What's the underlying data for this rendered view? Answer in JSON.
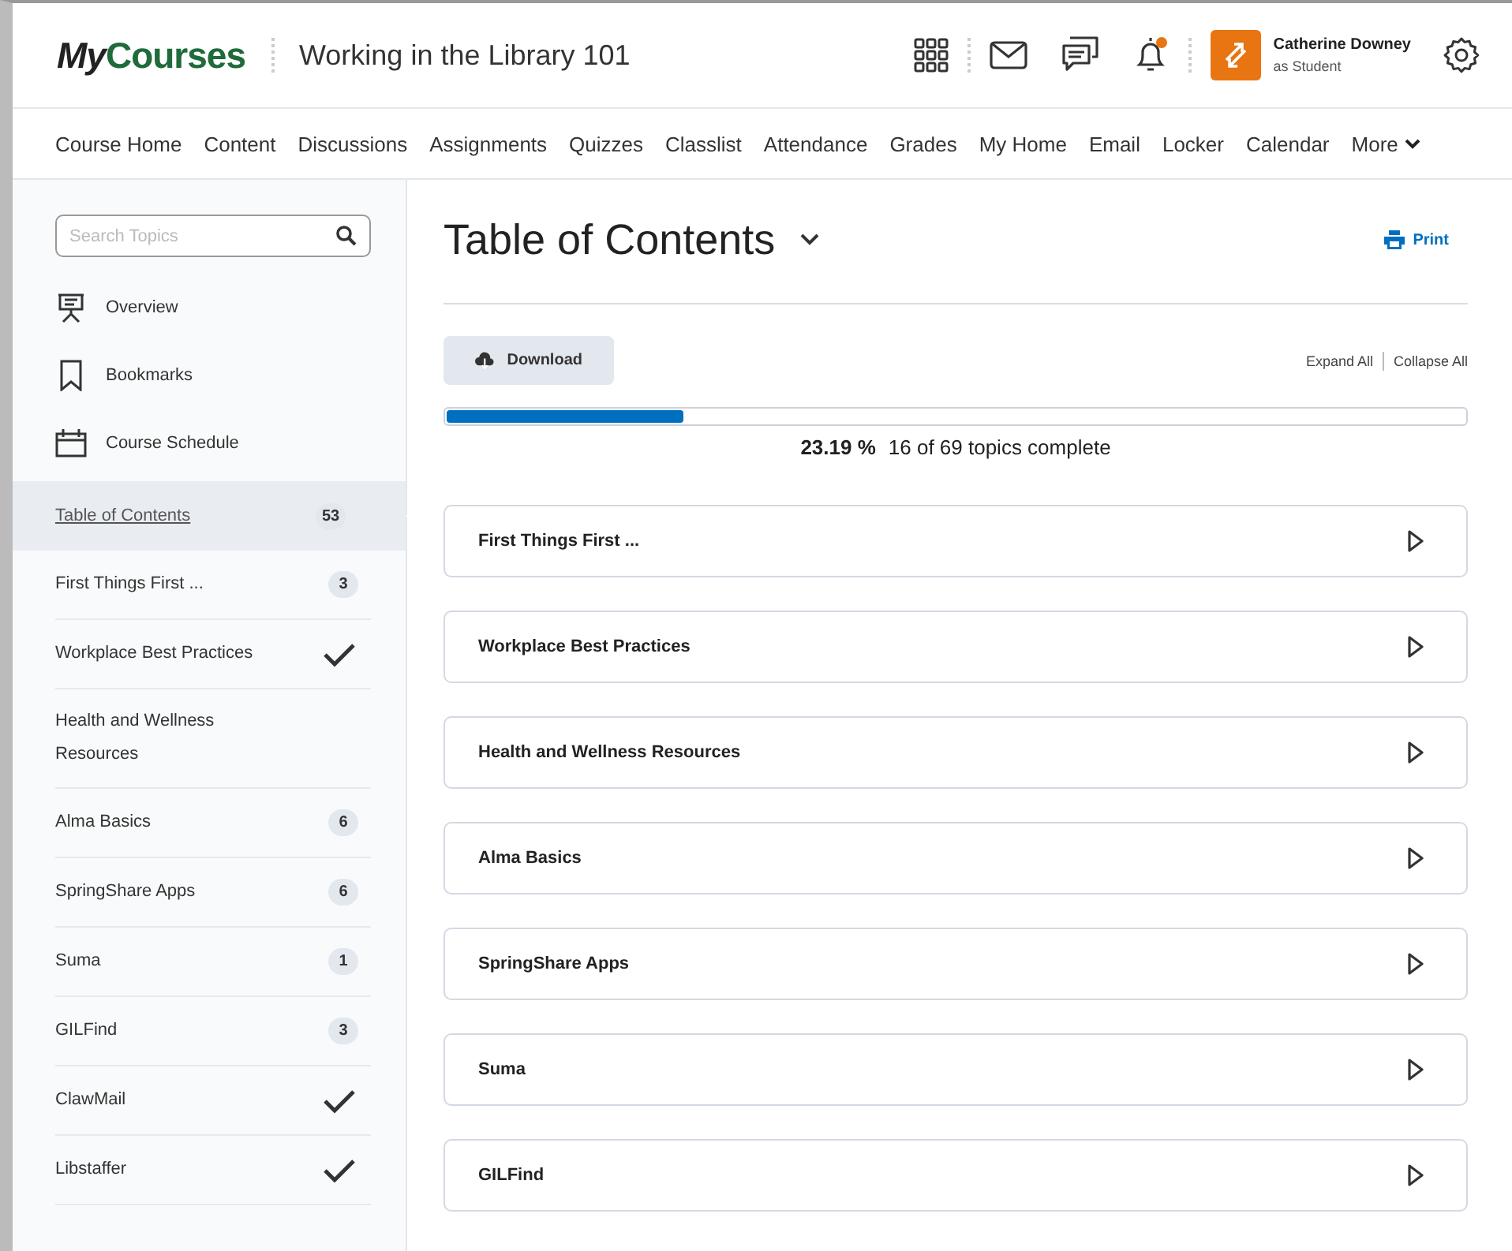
{
  "header": {
    "logo": {
      "part1": "My",
      "part2": "Courses"
    },
    "course_title": "Working in the Library 101",
    "notification_unread": true,
    "user": {
      "name": "Catherine Downey",
      "role": "as Student"
    }
  },
  "nav": {
    "items": [
      "Course Home",
      "Content",
      "Discussions",
      "Assignments",
      "Quizzes",
      "Classlist",
      "Attendance",
      "Grades",
      "My Home",
      "Email",
      "Locker",
      "Calendar"
    ],
    "more": "More"
  },
  "sidebar": {
    "search": {
      "placeholder": "Search Topics"
    },
    "links": [
      {
        "kind": "overview",
        "label": "Overview"
      },
      {
        "kind": "bookmarks",
        "label": "Bookmarks"
      },
      {
        "kind": "schedule",
        "label": "Course Schedule"
      }
    ],
    "modules": [
      {
        "label": "Table of Contents",
        "kind": "count",
        "count": "53",
        "selected": true
      },
      {
        "label": "First Things First ...",
        "kind": "count",
        "count": "3",
        "selected": false
      },
      {
        "label": "Workplace Best Practices",
        "kind": "done",
        "selected": false
      },
      {
        "label": "Health and Wellness Resources",
        "kind": "plain",
        "selected": false
      },
      {
        "label": "Alma Basics",
        "kind": "count",
        "count": "6",
        "selected": false
      },
      {
        "label": "SpringShare Apps",
        "kind": "count",
        "count": "6",
        "selected": false
      },
      {
        "label": "Suma",
        "kind": "count",
        "count": "1",
        "selected": false
      },
      {
        "label": "GILFind",
        "kind": "count",
        "count": "3",
        "selected": false
      },
      {
        "label": "ClawMail",
        "kind": "done",
        "selected": false
      },
      {
        "label": "Libstaffer",
        "kind": "done",
        "selected": false
      }
    ]
  },
  "main": {
    "title": "Table of Contents",
    "print": "Print",
    "download": "Download",
    "expand_all": "Expand All",
    "collapse_all": "Collapse All",
    "progress": {
      "level": 0.2319,
      "percent": "23.19 %",
      "summary": "16 of 69 topics complete"
    },
    "modules": [
      "First Things First ...",
      "Workplace Best Practices",
      "Health and Wellness Resources",
      "Alma Basics",
      "SpringShare Apps",
      "Suma",
      "GILFind"
    ]
  }
}
